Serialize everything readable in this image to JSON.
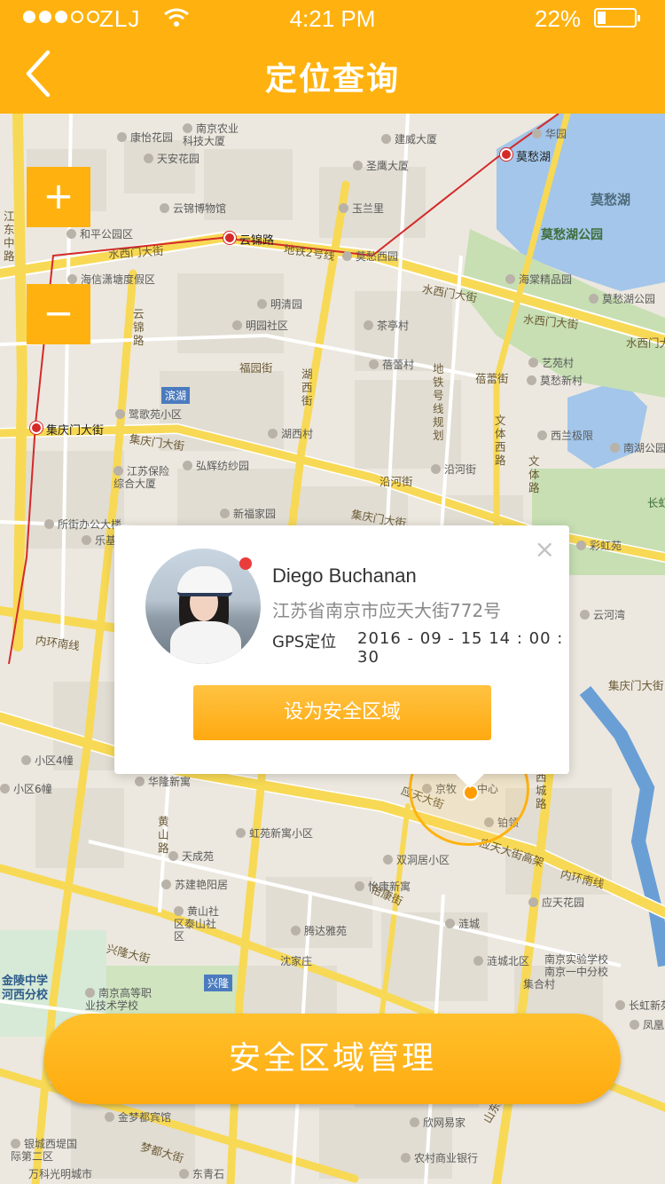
{
  "status_bar": {
    "carrier": "ZLJ",
    "time": "4:21 PM",
    "battery": "22%"
  },
  "nav": {
    "title": "定位查询",
    "back_icon": "chevron-left-icon"
  },
  "map": {
    "zoom_in": "+",
    "zoom_out": "−",
    "labels": {
      "l1": "康怡花园",
      "l2": "南京农业科技大厦",
      "l3": "建威大厦",
      "l4": "华园",
      "l5": "天安花园",
      "l6": "圣鹰大厦",
      "l7": "莫愁湖",
      "l8": "莫愁湖",
      "l9": "云锦博物馆",
      "l10": "玉兰里",
      "l11": "莫愁湖公园",
      "l12": "和平公园区",
      "l13": "云锦路",
      "l14": "地铁2号线",
      "l15": "莫愁西园",
      "l16": "水西门大街",
      "l17": "海信潇塘度假区",
      "l18": "海棠精品园",
      "l19": "水西门大街",
      "l20": "莫愁湖公园",
      "l21": "明清园",
      "l22": "水西门大街",
      "l23": "水西门大街",
      "l24": "明园社区",
      "l25": "茶亭村",
      "l26": "福园街",
      "l27": "蓓蕾村",
      "l28": "艺苑村",
      "l29": "滨湖",
      "l30": "蓓蕾街",
      "l31": "莫愁新村",
      "l32": "集庆门大街",
      "l33": "鹭歌苑小区",
      "l34": "湖西村",
      "l35": "西兰极限",
      "l36": "南湖公园",
      "l37": "集庆门大街",
      "l38": "江苏保险综合大厦",
      "l39": "弘辉纺纱园",
      "l40": "沿河街",
      "l41": "沿河街",
      "l42": "所街办公大楼",
      "l43": "新福家园",
      "l44": "集庆门大街",
      "l45": "乐基",
      "l46": "彩虹苑",
      "l47": "长虹",
      "l48": "内环南线",
      "l49": "云河湾",
      "l50": "集庆门大街",
      "l51": "小区4幢",
      "l52": "华隆新寓",
      "l53": "京牧",
      "l54": "中心",
      "l55": "小区6幢",
      "l56": "铂领",
      "l57": "虹苑新寓小区",
      "l58": "天成苑",
      "l59": "双洞居小区",
      "l60": "应天大街高架",
      "l61": "内环南线",
      "l62": "苏建艳阳居",
      "l63": "怡康新寓",
      "l64": "应天花园",
      "l65": "黄山社区泰山社区",
      "l66": "腾达雅苑",
      "l67": "涟城",
      "l68": "沈家庄",
      "l69": "兴隆大街",
      "l70": "涟城北区",
      "l71": "南京实验学校南京一中分校",
      "l72": "金陵中学河西分校",
      "l73": "南京高等职业技术学校",
      "l74": "兴隆",
      "l75": "集合村",
      "l76": "长虹新苑",
      "l77": "凤凰",
      "l78": "金梦都宾馆",
      "l79": "欣网易家",
      "l80": "银城西堤国际第二区",
      "l81": "梦都大街",
      "l82": "农村商业银行",
      "l83": "万科光明城市",
      "l84": "东青石",
      "l85": "江东中路",
      "l86": "湖西街",
      "l87": "云锦路",
      "l88": "文体西路",
      "l89": "文体路",
      "l90": "地铁号线规划",
      "l91": "怡康街",
      "l92": "黄山路",
      "l93": "西城路",
      "l94": "应天大街",
      "l95": "山东路"
    }
  },
  "popup": {
    "name": "Diego Buchanan",
    "address": "江苏省南京市应天大街772号",
    "source": "GPS定位",
    "datetime": "2016 - 09 - 15  14 : 00 : 30",
    "set_safe_zone": "设为安全区域",
    "close": "×"
  },
  "bottom": {
    "manage_label": "安全区域管理"
  },
  "colors": {
    "accent": "#ffb20f",
    "road_yellow": "#f8d955",
    "water": "#a3c6ea",
    "park": "#c7dfb3",
    "metro_red": "#d42a2a"
  }
}
